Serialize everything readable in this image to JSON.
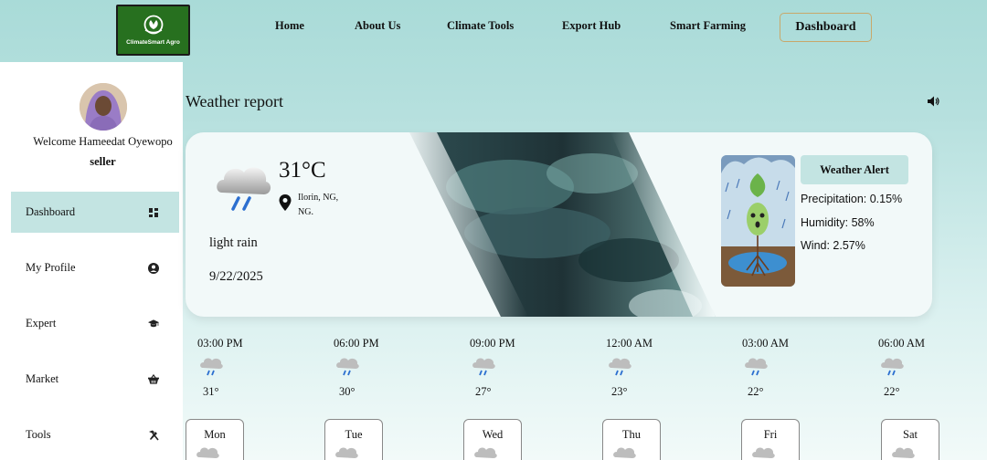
{
  "header": {
    "logo_text": "ClimateSmart Agro",
    "nav": {
      "home": "Home",
      "about": "About Us",
      "climate_tools": "Climate Tools",
      "export_hub": "Export Hub",
      "smart_farming": "Smart Farming",
      "dashboard": "Dashboard"
    }
  },
  "sidebar": {
    "welcome": "Welcome Hameedat Oyewopo",
    "role": "seller",
    "items": [
      {
        "label": "Dashboard",
        "icon": "grid-icon",
        "active": true
      },
      {
        "label": "My Profile",
        "icon": "user-circle-icon"
      },
      {
        "label": "Expert",
        "icon": "graduation-cap-icon"
      },
      {
        "label": "Market",
        "icon": "basket-icon"
      },
      {
        "label": "Tools",
        "icon": "hammer-icon"
      }
    ]
  },
  "weather": {
    "title": "Weather report",
    "temperature": "31°C",
    "location_line1": "Ilorin, NG,",
    "location_line2": "NG.",
    "condition": "light rain",
    "date": "9/22/2025",
    "alert": {
      "title": "Weather Alert",
      "precipitation": "Precipitation: 0.15%",
      "humidity": "Humidity: 58%",
      "wind": "Wind: 2.57%"
    }
  },
  "hourly": [
    {
      "time": "03:00 PM",
      "temp": "31°"
    },
    {
      "time": "06:00 PM",
      "temp": "30°"
    },
    {
      "time": "09:00 PM",
      "temp": "27°"
    },
    {
      "time": "12:00 AM",
      "temp": "23°"
    },
    {
      "time": "03:00 AM",
      "temp": "22°"
    },
    {
      "time": "06:00 AM",
      "temp": "22°"
    }
  ],
  "daily": [
    {
      "day": "Mon"
    },
    {
      "day": "Tue"
    },
    {
      "day": "Wed"
    },
    {
      "day": "Thu"
    },
    {
      "day": "Fri"
    },
    {
      "day": "Sat"
    }
  ],
  "colors": {
    "accent": "#c3e4e2",
    "logo_bg": "#27701f",
    "dashboard_border": "#c8a86a"
  }
}
